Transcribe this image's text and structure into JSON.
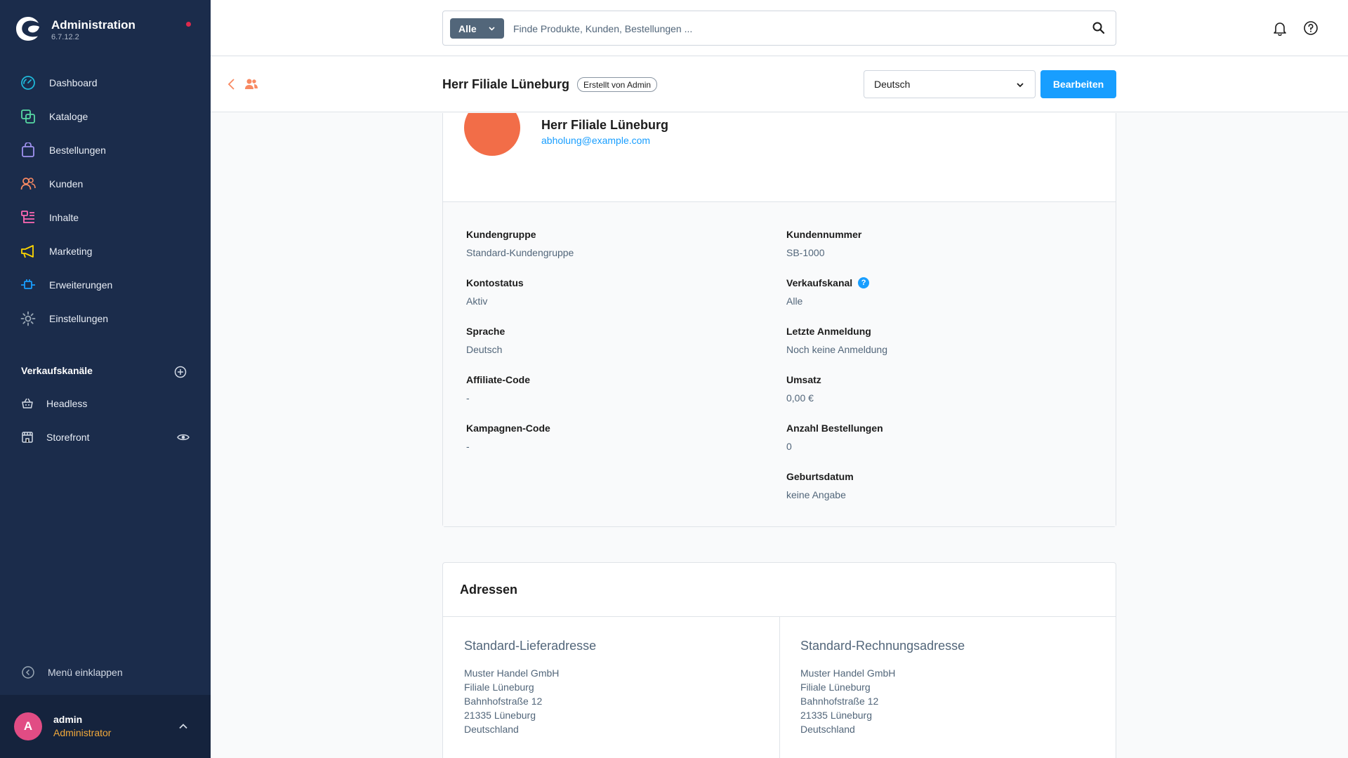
{
  "app": {
    "title": "Administration",
    "version": "6.7.12.2"
  },
  "nav": {
    "items": [
      {
        "label": "Dashboard",
        "icon": "dashboard-icon",
        "color": "#1fb8d9"
      },
      {
        "label": "Kataloge",
        "icon": "catalog-icon",
        "color": "#57d9a3"
      },
      {
        "label": "Bestellungen",
        "icon": "orders-icon",
        "color": "#a092f0"
      },
      {
        "label": "Kunden",
        "icon": "customers-icon",
        "color": "#f88962"
      },
      {
        "label": "Inhalte",
        "icon": "content-icon",
        "color": "#ff68b4"
      },
      {
        "label": "Marketing",
        "icon": "marketing-icon",
        "color": "#ffd700"
      },
      {
        "label": "Erweiterungen",
        "icon": "extensions-icon",
        "color": "#189eff"
      },
      {
        "label": "Einstellungen",
        "icon": "settings-icon",
        "color": "#9aa8b5"
      }
    ],
    "sales_channels_title": "Verkaufskanäle",
    "sales_channels": [
      {
        "label": "Headless",
        "icon": "basket-icon"
      },
      {
        "label": "Storefront",
        "icon": "storefront-icon"
      }
    ],
    "collapse_label": "Menü einklappen"
  },
  "user": {
    "initial": "A",
    "name": "admin",
    "role": "Administrator"
  },
  "search": {
    "type_label": "Alle",
    "placeholder": "Finde Produkte, Kunden, Bestellungen ..."
  },
  "smartbar": {
    "title": "Herr Filiale Lüneburg",
    "badge": "Erstellt von Admin",
    "language": "Deutsch",
    "edit_label": "Bearbeiten"
  },
  "customer": {
    "name": "Herr Filiale Lüneburg",
    "email": "abholung@example.com",
    "avatar_color": "#f26d48",
    "left_fields": [
      {
        "label": "Kundengruppe",
        "value": "Standard-Kundengruppe"
      },
      {
        "label": "Kontostatus",
        "value": "Aktiv"
      },
      {
        "label": "Sprache",
        "value": "Deutsch"
      },
      {
        "label": "Affiliate-Code",
        "value": "-"
      },
      {
        "label": "Kampagnen-Code",
        "value": "-"
      }
    ],
    "right_fields": [
      {
        "label": "Kundennummer",
        "value": "SB-1000"
      },
      {
        "label": "Verkaufskanal",
        "value": "Alle"
      },
      {
        "label": "Letzte Anmeldung",
        "value": "Noch keine Anmeldung"
      },
      {
        "label": "Umsatz",
        "value": "0,00 €"
      },
      {
        "label": "Anzahl Bestellungen",
        "value": "0"
      },
      {
        "label": "Geburtsdatum",
        "value": "keine Angabe"
      }
    ],
    "info_glyph": "?"
  },
  "addresses": {
    "title": "Adressen",
    "shipping": {
      "heading": "Standard-Lieferadresse",
      "lines": [
        "Muster Handel GmbH",
        "Filiale Lüneburg",
        "Bahnhofstraße 12",
        "21335 Lüneburg",
        "Deutschland"
      ]
    },
    "billing": {
      "heading": "Standard-Rechnungsadresse",
      "lines": [
        "Muster Handel GmbH",
        "Filiale Lüneburg",
        "Bahnhofstraße 12",
        "21335 Lüneburg",
        "Deutschland"
      ]
    }
  },
  "colors": {
    "sidebar_bg": "#1b2c4b",
    "accent": "#189eff",
    "notification_dot": "#de294c"
  }
}
